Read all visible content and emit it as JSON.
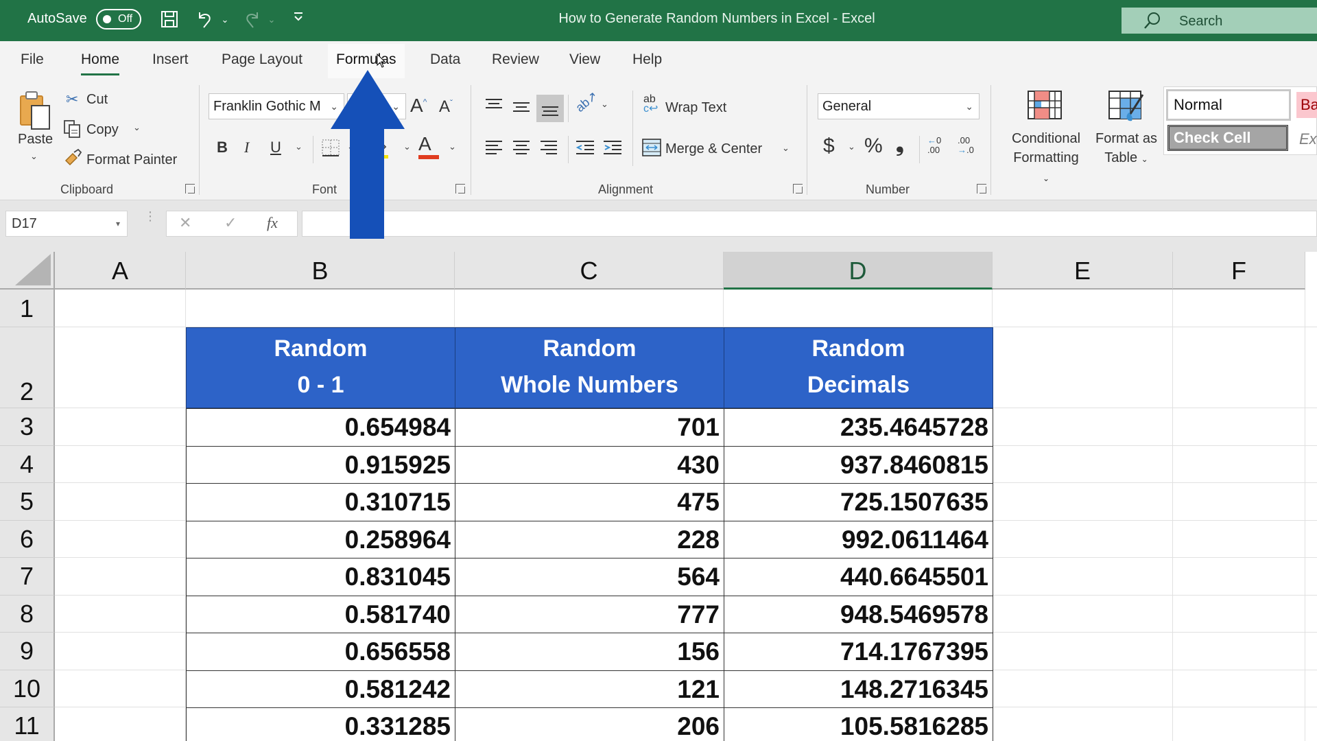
{
  "titlebar": {
    "autosave_label": "AutoSave",
    "autosave_state": "Off",
    "title": "How to Generate Random Numbers in Excel  -  Excel",
    "search_placeholder": "Search",
    "icons": [
      "save-icon",
      "undo-icon",
      "undo-dropdown-icon",
      "redo-icon",
      "redo-dropdown-icon",
      "customize-quick-access-icon"
    ],
    "color": "#217346"
  },
  "tabs": [
    {
      "label": "File"
    },
    {
      "label": "Home",
      "active": true
    },
    {
      "label": "Insert"
    },
    {
      "label": "Page Layout"
    },
    {
      "label": "Formulas",
      "hover": true
    },
    {
      "label": "Data"
    },
    {
      "label": "Review"
    },
    {
      "label": "View"
    },
    {
      "label": "Help"
    }
  ],
  "ribbon": {
    "clipboard": {
      "label": "Clipboard",
      "paste": "Paste",
      "cut": "Cut",
      "copy": "Copy",
      "format_painter": "Format Painter"
    },
    "font": {
      "label": "Font",
      "font_name": "Franklin Gothic M",
      "font_size": "",
      "bold": "B",
      "italic": "I",
      "underline": "U",
      "font_color_swatch": "#e03c1f",
      "highlight_swatch": "#f5e40a"
    },
    "alignment": {
      "label": "Alignment",
      "wrap_text": "Wrap Text",
      "merge_center": "Merge & Center"
    },
    "number": {
      "label": "Number",
      "format": "General",
      "currency": "$",
      "percent": "%",
      "comma": "9",
      "inc_decimal": "←0 .00",
      "dec_decimal": ".00 →0"
    },
    "styles": {
      "conditional_formatting": [
        "Conditional",
        "Formatting"
      ],
      "format_as_table": [
        "Format as",
        "Table"
      ],
      "normal": "Normal",
      "bad": "Ba",
      "check_cell": "Check Cell",
      "explanatory": "Ex"
    }
  },
  "formula_bar": {
    "name_box": "D17",
    "cancel": "✕",
    "enter": "✓",
    "fx": "fx",
    "value": ""
  },
  "sheet": {
    "columns": [
      "A",
      "B",
      "C",
      "D",
      "E",
      "F"
    ],
    "selected_column": "D",
    "rows": [
      "1",
      "2",
      "3",
      "4",
      "5",
      "6",
      "7",
      "8",
      "9",
      "10",
      "11"
    ],
    "header_color": "#2d63c8",
    "table_headers": [
      [
        "Random",
        "0 - 1"
      ],
      [
        "Random",
        "Whole Numbers"
      ],
      [
        "Random",
        "Decimals"
      ]
    ],
    "table_rows": [
      [
        "0.654984",
        "701",
        "235.4645728"
      ],
      [
        "0.915925",
        "430",
        "937.8460815"
      ],
      [
        "0.310715",
        "475",
        "725.1507635"
      ],
      [
        "0.258964",
        "228",
        "992.0611464"
      ],
      [
        "0.831045",
        "564",
        "440.6645501"
      ],
      [
        "0.581740",
        "777",
        "948.5469578"
      ],
      [
        "0.656558",
        "156",
        "714.1767395"
      ],
      [
        "0.581242",
        "121",
        "148.2716345"
      ],
      [
        "0.331285",
        "206",
        "105.5816285"
      ]
    ]
  },
  "overlay": {
    "arrow_color": "#1550b8",
    "arrow_points_to": "Formulas"
  }
}
